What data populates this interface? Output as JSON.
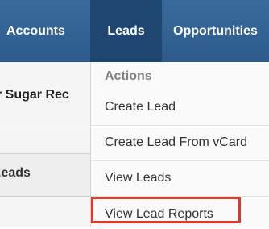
{
  "nav": {
    "accounts_label": "Accounts",
    "leads_label": "Leads",
    "opportunities_label": "Opportunities"
  },
  "sidebar": {
    "sugar_label": "r Sugar Rec",
    "leads_label": ".eads"
  },
  "menu": {
    "header": "Actions",
    "items": [
      {
        "label": "Create Lead"
      },
      {
        "label": "Create Lead From vCard"
      },
      {
        "label": "View Leads"
      },
      {
        "label": "View Lead Reports"
      }
    ]
  },
  "colors": {
    "nav_bg": "#2d5a8a",
    "nav_active_bg": "#1f4670",
    "highlight_border": "#e0392b"
  }
}
